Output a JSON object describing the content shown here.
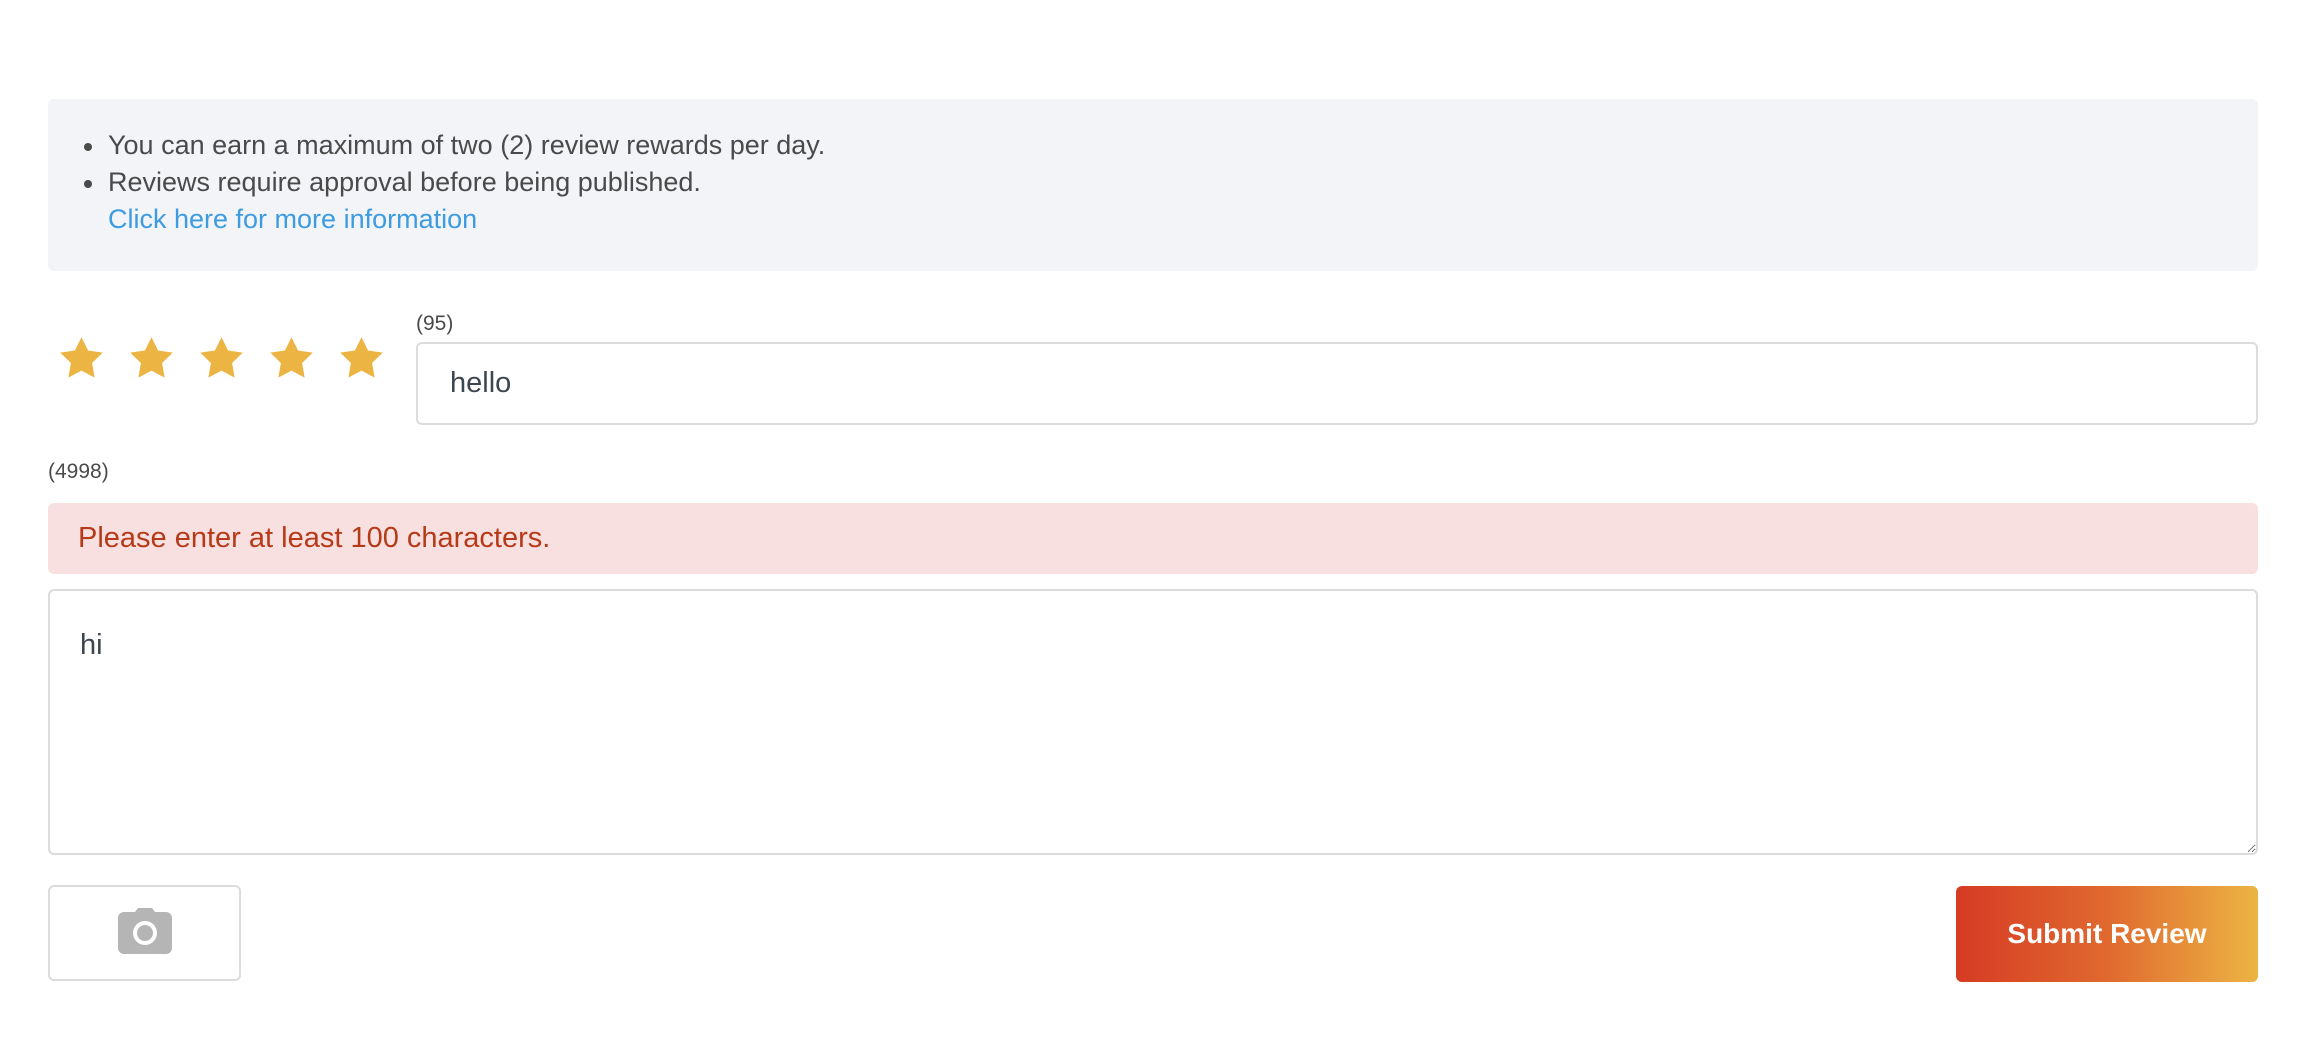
{
  "info": {
    "items": [
      "You can earn a maximum of two (2) review rewards per day.",
      "Reviews require approval before being published."
    ],
    "link_text": "Click here for more information",
    "link_color": "#3d9be0",
    "background_color": "#f2f4f8"
  },
  "rating": {
    "stars_total": 5,
    "stars_selected": 5,
    "star_color": "#ecb443",
    "star_icon": "star-icon"
  },
  "title_field": {
    "counter": "(95)",
    "value": "hello"
  },
  "body_field": {
    "counter": "(4998)",
    "error": "Please enter at least 100 characters.",
    "value": "hi"
  },
  "photo_button": {
    "icon": "camera-icon",
    "icon_color": "#b5b5b5"
  },
  "submit_button": {
    "label": "Submit Review",
    "gradient_start": "#d63b24",
    "gradient_end": "#ecb443"
  },
  "colors": {
    "error_bg": "#f9e0e0",
    "error_text": "#b63a17",
    "border": "#dcdcdc"
  }
}
